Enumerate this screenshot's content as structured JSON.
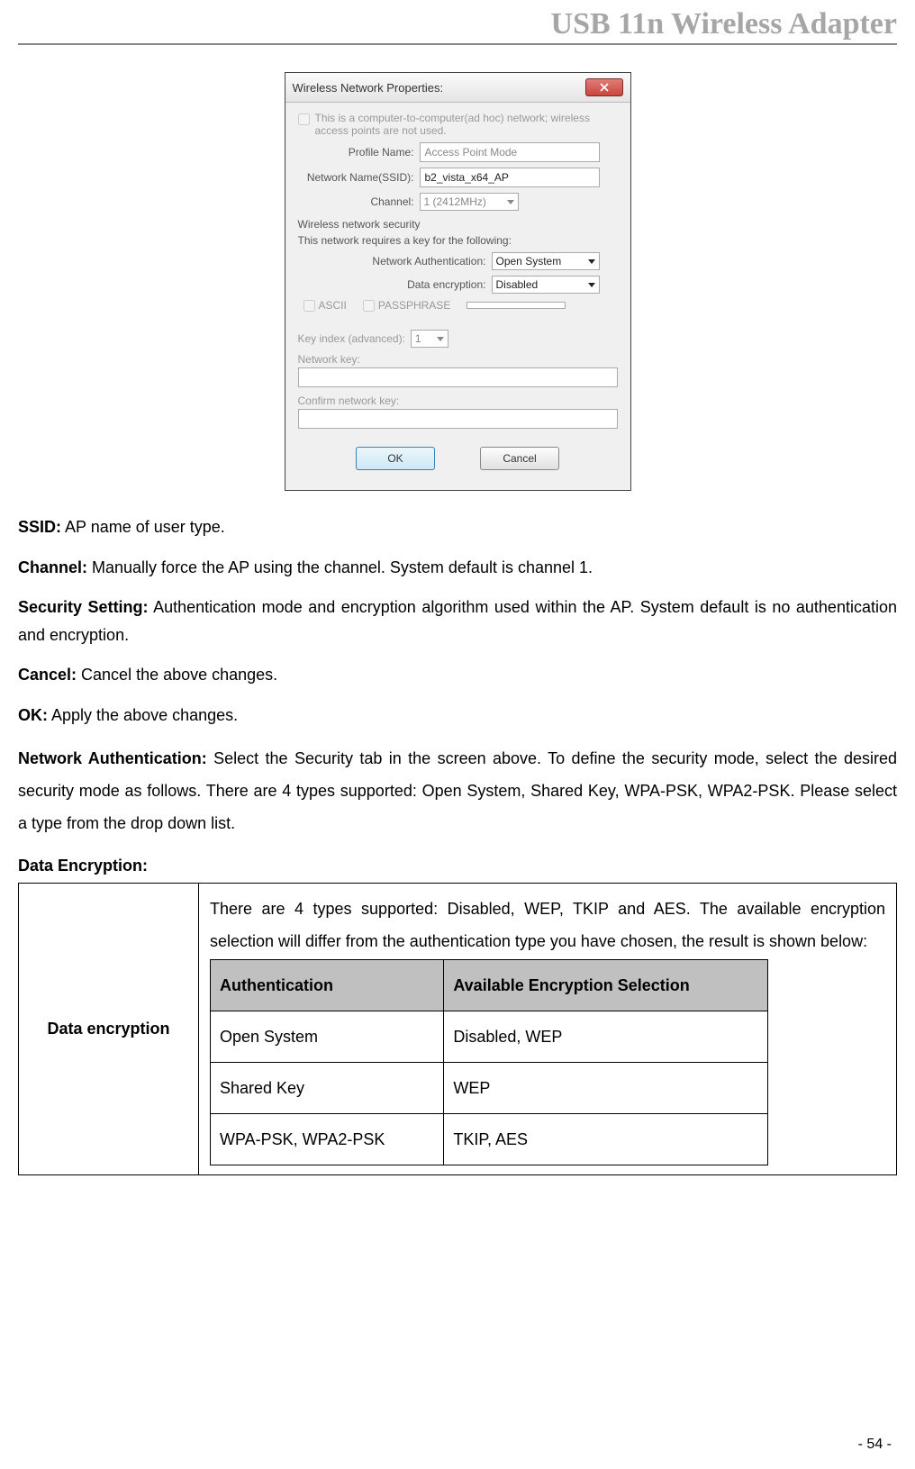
{
  "header": {
    "title": "USB 11n Wireless Adapter"
  },
  "dialog": {
    "title": "Wireless Network Properties:",
    "adhoc_text": "This is a computer-to-computer(ad hoc) network; wireless access points are not used.",
    "profile_label": "Profile Name:",
    "profile_value": "Access Point Mode",
    "ssid_label": "Network Name(SSID):",
    "ssid_value": "b2_vista_x64_AP",
    "channel_label": "Channel:",
    "channel_value": "1 (2412MHz)",
    "security_group": "Wireless network security",
    "security_desc": "This network requires a key for the following:",
    "netauth_label": "Network Authentication:",
    "netauth_value": "Open System",
    "dataenc_label": "Data encryption:",
    "dataenc_value": "Disabled",
    "ascii_label": "ASCII",
    "passphrase_label": "PASSPHRASE",
    "keyindex_label": "Key index (advanced):",
    "keyindex_value": "1",
    "networkkey_label": "Network key:",
    "confirmkey_label": "Confirm network key:",
    "ok": "OK",
    "cancel": "Cancel"
  },
  "body": {
    "ssid_label": "SSID:",
    "ssid_text": " AP name of user type.",
    "channel_label": "Channel:",
    "channel_text": " Manually force the AP using the channel. System default is channel 1.",
    "security_label": "Security Setting:",
    "security_text": " Authentication mode and encryption algorithm used within the AP. System default is no authentication and encryption.",
    "cancel_label": "Cancel:",
    "cancel_text": " Cancel the above changes.",
    "ok_label": "OK:",
    "ok_text": " Apply the above changes.",
    "na_label": "Network Authentication:",
    "na_text": " Select the Security tab in the screen above. To define the security mode, select the desired security mode as follows. There are 4 types supported: Open System, Shared Key, WPA-PSK, WPA2-PSK. Please select a type from the drop down list.",
    "de_label": "Data Encryption:",
    "table_label": "Data encryption",
    "table_desc": "There are 4 types supported: Disabled, WEP, TKIP and AES. The available encryption selection will differ from the authentication type you have chosen, the result is shown below:",
    "inner": {
      "h1": "Authentication",
      "h2": "Available Encryption Selection",
      "rows": [
        {
          "a": "Open System",
          "b": "Disabled, WEP"
        },
        {
          "a": "Shared Key",
          "b": "WEP"
        },
        {
          "a": "WPA-PSK, WPA2-PSK",
          "b": "TKIP, AES"
        }
      ]
    }
  },
  "page_number": "- 54 -"
}
